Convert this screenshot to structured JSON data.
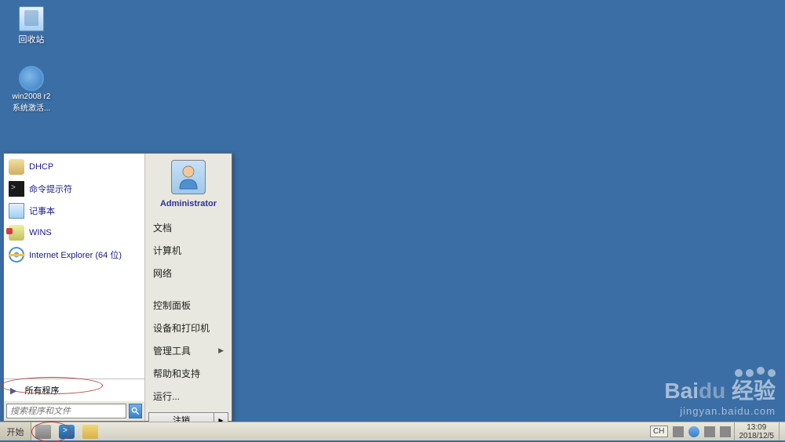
{
  "desktop": {
    "recycle_bin_label": "回收站",
    "activation_label": "win2008 r2\n系统激活..."
  },
  "start_menu": {
    "left_programs": [
      {
        "icon": "dhcp-icon",
        "label": "DHCP"
      },
      {
        "icon": "cmd-icon",
        "label": "命令提示符"
      },
      {
        "icon": "notepad-icon",
        "label": "记事本"
      },
      {
        "icon": "wins-icon",
        "label": "WINS"
      },
      {
        "icon": "ie-icon",
        "label": "Internet Explorer (64 位)"
      }
    ],
    "all_programs_label": "所有程序",
    "search_placeholder": "搜索程序和文件",
    "user_name": "Administrator",
    "right_items": [
      {
        "label": "文档",
        "has_sub": false
      },
      {
        "label": "计算机",
        "has_sub": false
      },
      {
        "label": "网络",
        "has_sub": false
      },
      {
        "label": "控制面板",
        "has_sub": false
      },
      {
        "label": "设备和打印机",
        "has_sub": false
      },
      {
        "label": "管理工具",
        "has_sub": true
      },
      {
        "label": "帮助和支持",
        "has_sub": false
      },
      {
        "label": "运行...",
        "has_sub": false
      }
    ],
    "logoff_label": "注销"
  },
  "taskbar": {
    "start_label": "开始",
    "language": "CH",
    "time": "13:09",
    "date": "2018/12/5"
  },
  "watermark": {
    "main": "Bai",
    "du": "du",
    "brand": "经验",
    "sub": "jingyan.baidu.com"
  }
}
